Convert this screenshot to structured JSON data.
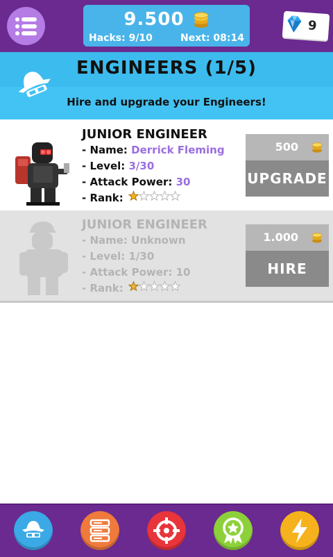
{
  "topbar": {
    "coins": "9.500",
    "hacks": "Hacks: 9/10",
    "next": "Next: 08:14",
    "gems": "9",
    "icons": [
      "menu-icon",
      "coin-icon",
      "diamond-icon"
    ]
  },
  "section": {
    "title": "ENGINEERS (1/5)",
    "subtitle": "Hire and upgrade your Engineers!",
    "icon": "hacker-hat-icon"
  },
  "engineers": [
    {
      "title": "JUNIOR ENGINEER",
      "name_label": "- Name: ",
      "name": "Derrick Fleming",
      "level_label": "- Level: ",
      "level": "3/30",
      "attack_label": "- Attack Power: ",
      "attack": "30",
      "rank_label": "- Rank: ",
      "rank_stars": 1,
      "rank_max": 5,
      "price": "500",
      "action": "UPGRADE",
      "locked": false
    },
    {
      "title": "JUNIOR ENGINEER",
      "name_label": "- Name: ",
      "name": "Unknown",
      "level_label": "- Level: ",
      "level": "1/30",
      "attack_label": "- Attack Power: ",
      "attack": "10",
      "rank_label": "- Rank: ",
      "rank_stars": 1,
      "rank_max": 5,
      "price": "1.000",
      "action": "HIRE",
      "locked": true
    }
  ],
  "bottom_nav": {
    "items": [
      "hacker-icon",
      "servers-icon",
      "target-icon",
      "badge-icon",
      "lightning-icon"
    ]
  },
  "colors": {
    "purple": "#6a2a8f",
    "sky": "#43c3f3",
    "accent_value": "#9a6ee0",
    "nav_blue": "#3aa9e6",
    "nav_orange": "#ef7a3c",
    "nav_red": "#e8343b",
    "nav_green": "#8dd13a",
    "nav_yellow": "#f6b21c"
  }
}
